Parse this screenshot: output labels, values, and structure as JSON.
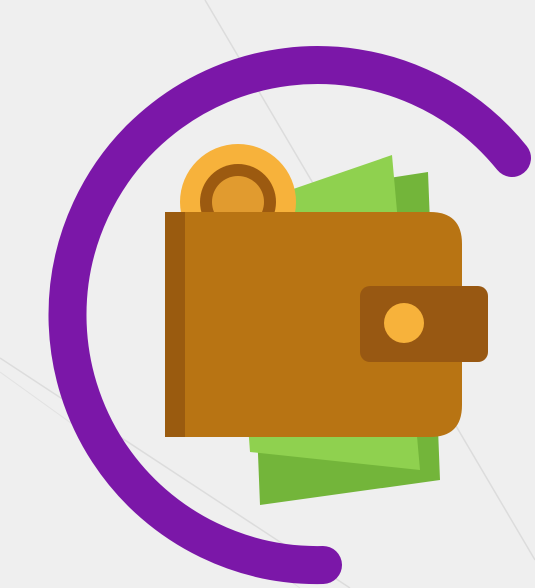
{
  "illustration": {
    "subject": "wallet-icon",
    "colors": {
      "background": "#efefef",
      "background_lines": "#dcdcdc",
      "ring": "#7b17a8",
      "wallet_body": "#b87413",
      "wallet_edge": "#9a5b0f",
      "clasp": "#985812",
      "clasp_button": "#f7b23b",
      "coin_outer": "#f7b23b",
      "coin_inner": "#e19b2f",
      "coin_ring": "#9c5a10",
      "bill_front": "#8fd14f",
      "bill_back": "#73b53a"
    }
  }
}
